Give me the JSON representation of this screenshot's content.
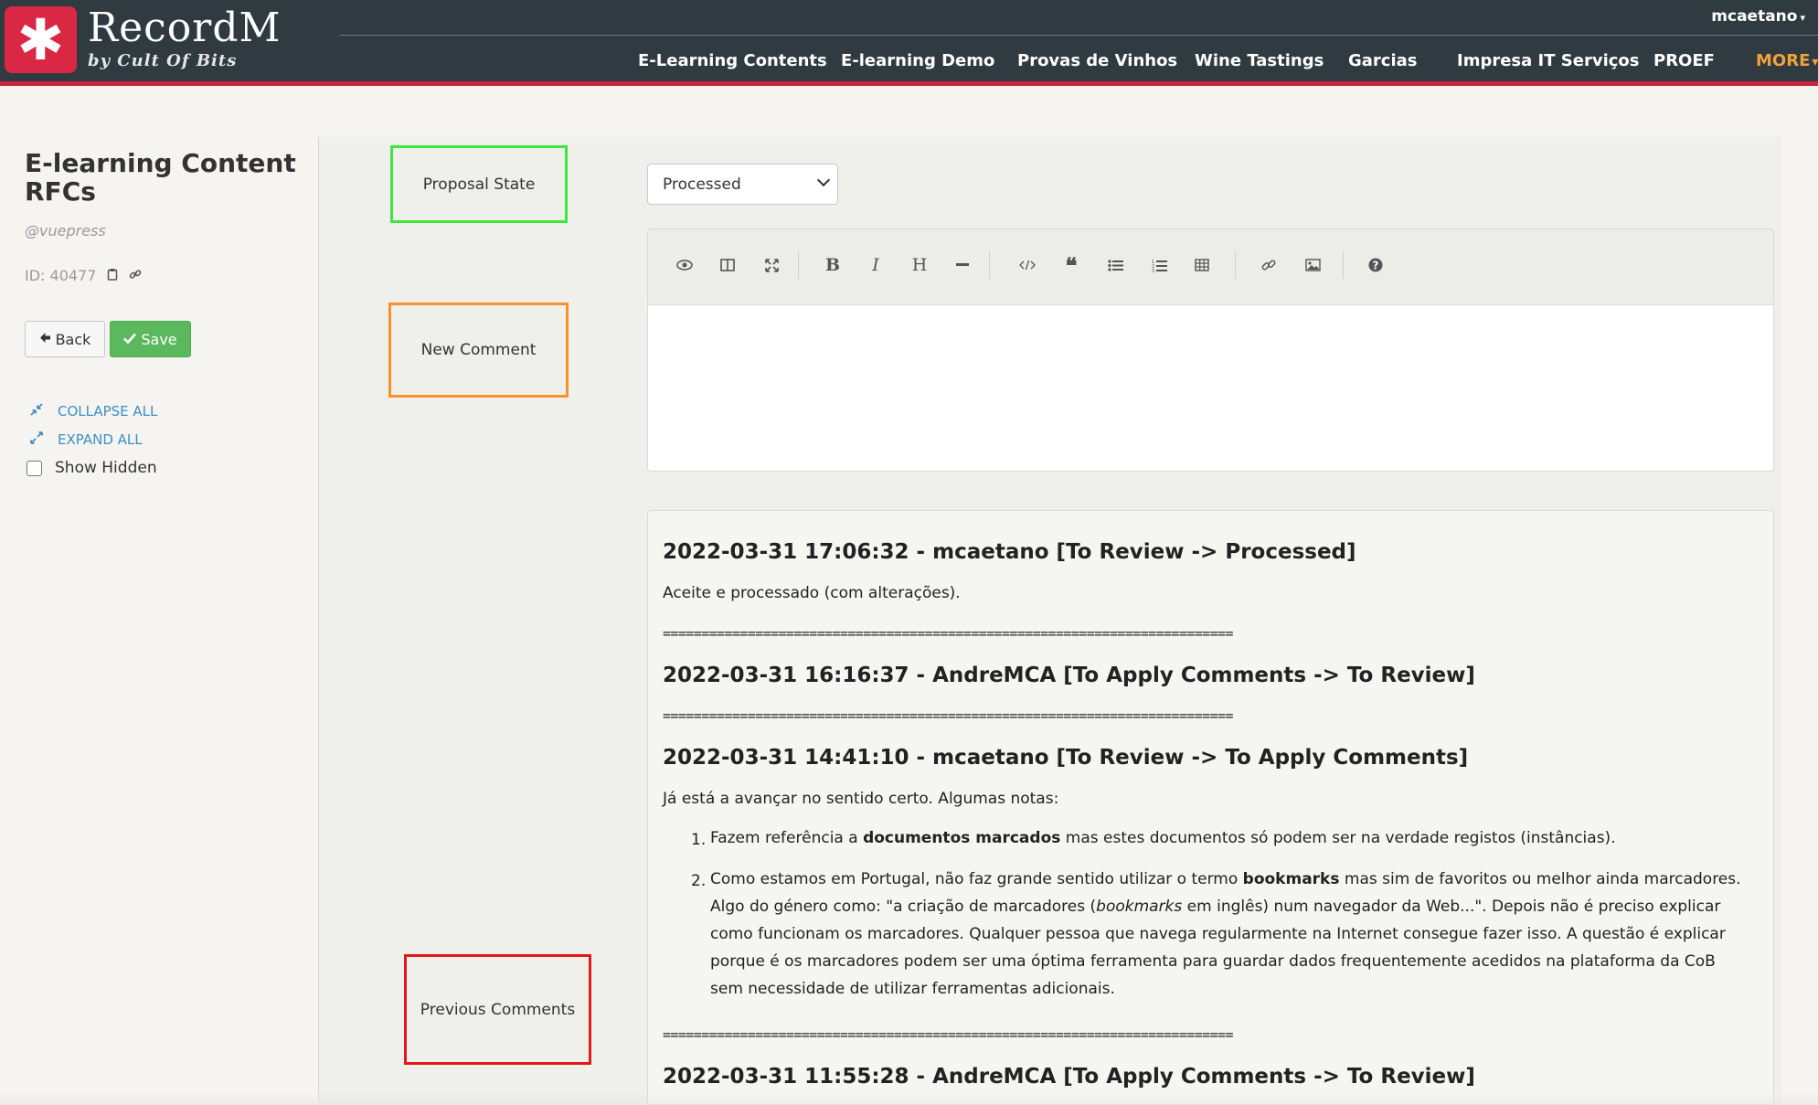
{
  "app": {
    "logo_glyph": "✱",
    "name": "RecordM",
    "byline": "by Cult Of Bits",
    "user": "mcaetano",
    "user_caret": "▾",
    "brand_color": "#d92744",
    "topbar_color": "#2f3b40",
    "more_color": "#f0a33a"
  },
  "nav": {
    "items": [
      {
        "label": "E-Learning Contents"
      },
      {
        "label": "E-learning Demo"
      },
      {
        "label": "Provas de Vinhos"
      },
      {
        "label": "Wine Tastings"
      },
      {
        "label": "Garcias"
      },
      {
        "label": "Impresa IT Serviços"
      },
      {
        "label": "PROEF"
      }
    ],
    "more_label": "MORE",
    "more_caret": "▾"
  },
  "sidebar": {
    "title": "E-learning Content RFCs",
    "handle": "@vuepress",
    "id_label": "ID: 40477",
    "copy_icon": "clipboard-icon",
    "link_icon": "link-icon",
    "back_label": "Back",
    "save_label": "Save",
    "collapse_all": "COLLAPSE ALL",
    "expand_all": "EXPAND ALL",
    "show_hidden": "Show Hidden",
    "show_hidden_checked": false
  },
  "annotations": {
    "proposal_state": "Proposal State",
    "new_comment": "New Comment",
    "previous_comments": "Previous Comments"
  },
  "form": {
    "proposal_state_value": "Processed",
    "new_comment_value": ""
  },
  "toolbar": {
    "buttons": [
      "preview-icon",
      "side-by-side-icon",
      "fullscreen-icon",
      "bold-icon",
      "italic-icon",
      "heading-icon",
      "horizontal-rule-icon",
      "code-icon",
      "quote-icon",
      "unordered-list-icon",
      "ordered-list-icon",
      "table-icon",
      "link-icon",
      "image-icon",
      "help-icon"
    ]
  },
  "comments": {
    "separator": "==========================================================================",
    "entries": [
      {
        "header": "2022-03-31 17:06:32 - mcaetano [To Review -> Processed]",
        "body": "Aceite e processado (com alterações)."
      },
      {
        "header": "2022-03-31 16:16:37 - AndreMCA [To Apply Comments -> To Review]"
      },
      {
        "header": "2022-03-31 14:41:10 - mcaetano [To Review -> To Apply Comments]",
        "intro": "Já está a avançar no sentido certo. Algumas notas:",
        "items": [
          {
            "num": "1.",
            "pre": "Fazem referência a ",
            "bold": "documentos marcados",
            "post": " mas estes documentos só podem ser na verdade registos (instâncias)."
          },
          {
            "num": "2.",
            "pre": "Como estamos em Portugal, não faz grande sentido utilizar o termo ",
            "bold": "bookmarks",
            "mid": " mas sim de favoritos ou melhor ainda marcadores. Algo do género como: \"a criação de marcadores (",
            "italic": "bookmarks",
            "post": " em inglês) num navegador da Web...\". Depois não é preciso explicar como funcionam os marcadores. Qualquer pessoa que navega regularmente na Internet consegue fazer isso. A questão é explicar porque é os marcadores podem ser uma óptima ferramenta para guardar dados frequentemente acedidos na plataforma da CoB sem necessidade de utilizar ferramentas adicionais."
          }
        ]
      },
      {
        "header": "2022-03-31 11:55:28 - AndreMCA [To Apply Comments -> To Review]"
      }
    ]
  }
}
